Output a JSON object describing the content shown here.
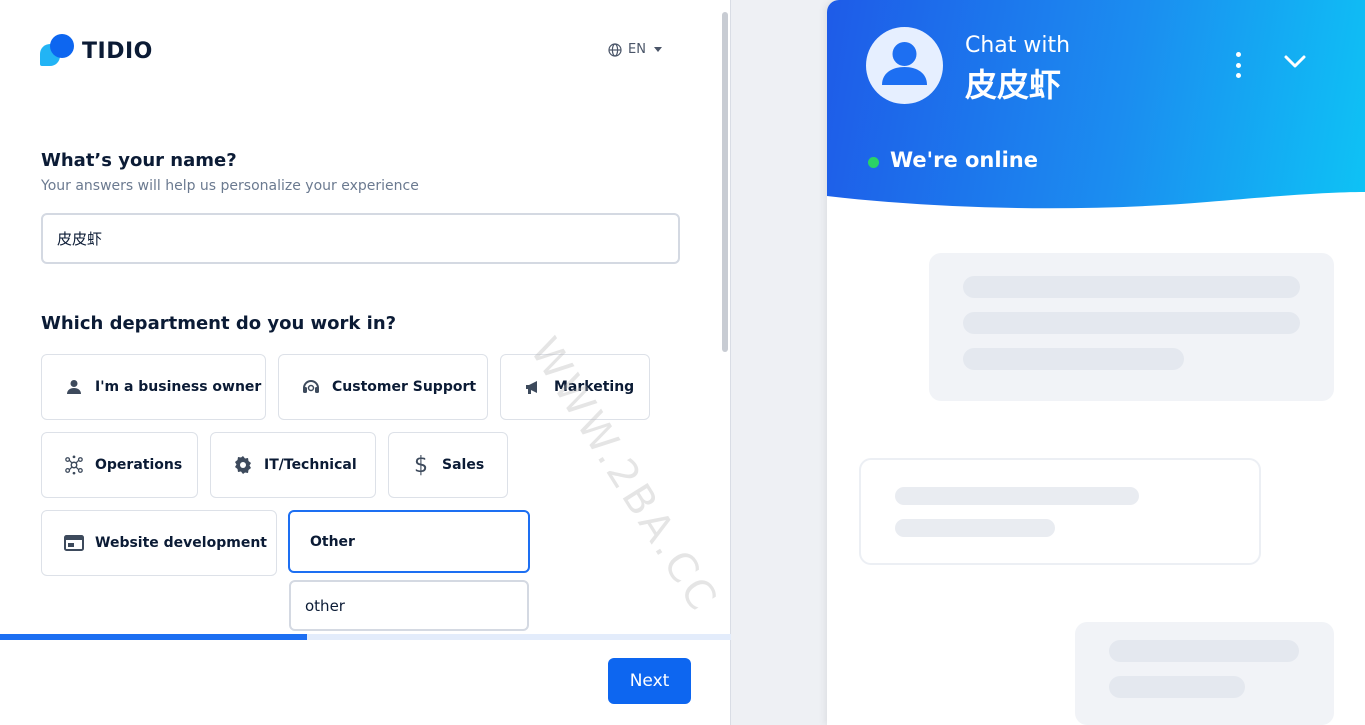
{
  "brand": {
    "name": "TIDIO",
    "accent": "#0d66f0"
  },
  "language": {
    "label": "EN",
    "icon": "globe-icon"
  },
  "form": {
    "name_question": "What’s your name?",
    "name_hint": "Your answers will help us personalize your experience",
    "name_value": "皮皮虾",
    "department_question": "Which department do you work in?",
    "departments": [
      {
        "label": "I'm a business owner",
        "icon": "person-icon"
      },
      {
        "label": "Customer Support",
        "icon": "headset-icon"
      },
      {
        "label": "Marketing",
        "icon": "megaphone-icon"
      },
      {
        "label": "Operations",
        "icon": "network-icon"
      },
      {
        "label": "IT/Technical",
        "icon": "gear-icon"
      },
      {
        "label": "Sales",
        "icon": "dollar-icon"
      },
      {
        "label": "Website development",
        "icon": "browser-window-icon"
      },
      {
        "label": "Other",
        "icon": "",
        "selected": true
      }
    ],
    "other_value": "other",
    "progress_fraction": 0.42,
    "next_label": "Next"
  },
  "watermark": "WWW.2BA.CC",
  "chat": {
    "title": "Chat with",
    "name": "皮皮虾",
    "status": "We're online",
    "status_color": "#2ad365"
  }
}
